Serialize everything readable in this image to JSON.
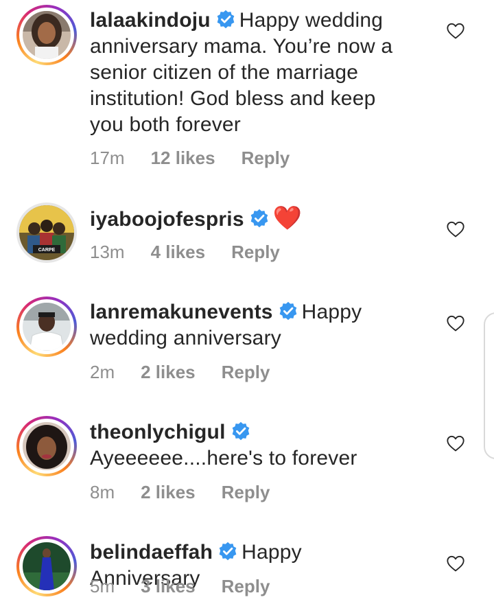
{
  "comments": [
    {
      "username": "lalaakindoju",
      "text": "Happy wedding anniversary mama. You’re now a senior citizen of the marriage institution! God bless and keep you both forever",
      "time": "17m",
      "likes": "12 likes",
      "reply": "Reply"
    },
    {
      "username": "iyaboojofespris",
      "text": "❤️",
      "time": "13m",
      "likes": "4 likes",
      "reply": "Reply",
      "avatar_text": "CARPE"
    },
    {
      "username": "lanremakunevents",
      "text": "Happy wedding anniversary",
      "time": "2m",
      "likes": "2 likes",
      "reply": "Reply"
    },
    {
      "username": "theonlychigul",
      "text": "Ayeeeeee....here's to forever",
      "time": "8m",
      "likes": "2 likes",
      "reply": "Reply"
    },
    {
      "username": "belindaeffah",
      "text": "Happy Anniversary",
      "time": "5m",
      "likes": "3 likes",
      "reply": "Reply"
    }
  ],
  "colors": {
    "verified_badge": "#3897f0",
    "meta_text": "#8e8e8e",
    "heart_emoji": "#e0192e"
  },
  "icons": {
    "verified": "verified-badge-icon",
    "like": "heart-outline-icon"
  }
}
